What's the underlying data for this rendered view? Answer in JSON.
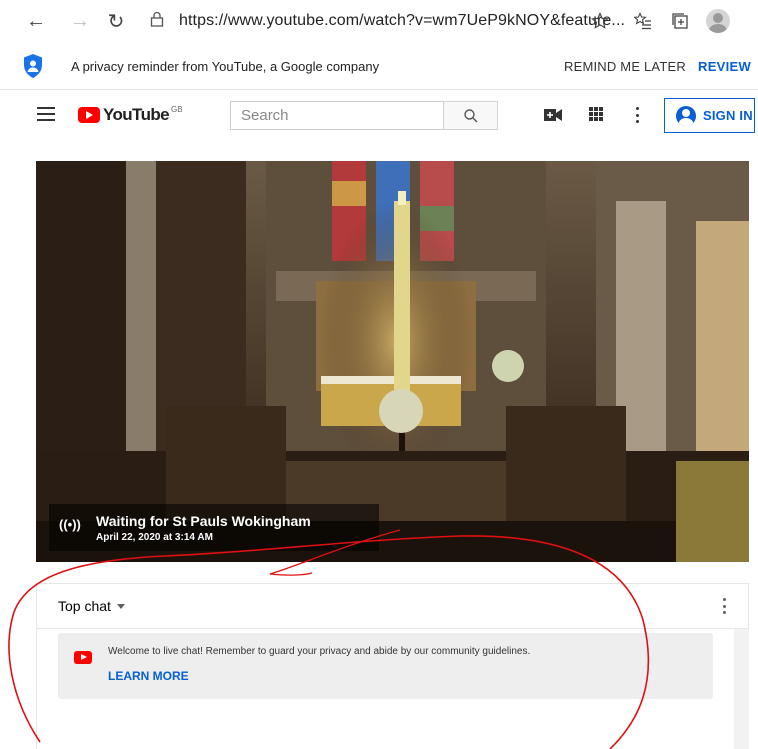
{
  "browser": {
    "back_icon": "←",
    "forward_icon": "→",
    "refresh_icon": "↻",
    "url": "https://www.youtube.com/watch?v=wm7UeP9kNOY&feature...",
    "icons": [
      "back-arrow-icon",
      "forward-arrow-icon",
      "refresh-icon",
      "lock-icon",
      "favorite-star-icon",
      "favorites-icon",
      "collections-icon",
      "profile-icon"
    ]
  },
  "privacy": {
    "message": "A privacy reminder from YouTube, a Google company",
    "remind_label": "REMIND ME LATER",
    "review_label": "REVIEW"
  },
  "masthead": {
    "logo_text": "YouTube",
    "region": "GB",
    "search_placeholder": "Search",
    "signin_label": "SIGN IN"
  },
  "player": {
    "title": "Waiting for St Pauls Wokingham",
    "date": "April 22, 2020 at 3:14 AM",
    "live_icon": "((•))"
  },
  "chat": {
    "mode_label": "Top chat",
    "welcome": "Welcome to live chat! Remember to guard your privacy and abide by our community guidelines.",
    "learn_more": "LEARN MORE"
  },
  "colors": {
    "youtube_red": "#ff0000",
    "link_blue": "#065fd4",
    "annotation_red": "#e01010"
  }
}
